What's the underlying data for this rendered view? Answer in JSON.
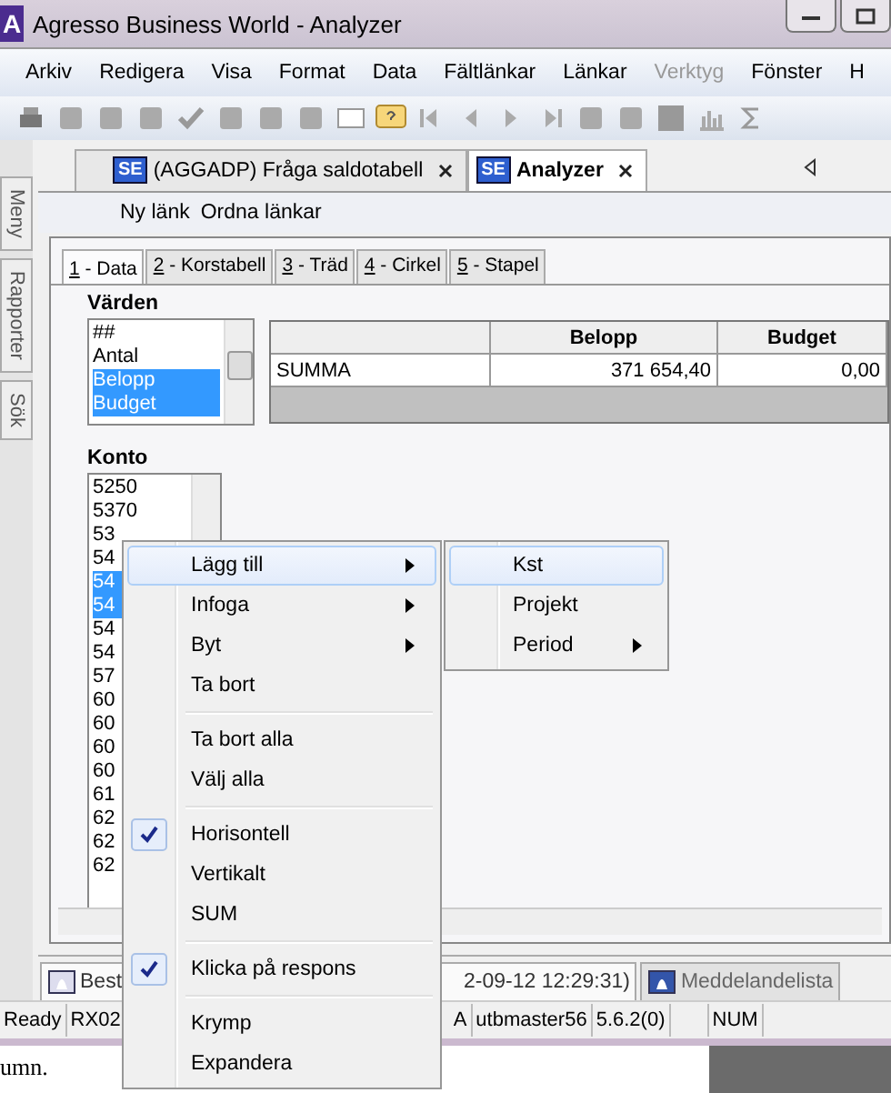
{
  "window": {
    "title": "Agresso Business World - Analyzer",
    "logo": "A"
  },
  "menu_bar": [
    {
      "label": "Arkiv",
      "disabled": false
    },
    {
      "label": "Redigera",
      "disabled": false
    },
    {
      "label": "Visa",
      "disabled": false
    },
    {
      "label": "Format",
      "disabled": false
    },
    {
      "label": "Data",
      "disabled": false
    },
    {
      "label": "Fältlänkar",
      "disabled": false
    },
    {
      "label": "Länkar",
      "disabled": false
    },
    {
      "label": "Verktyg",
      "disabled": true
    },
    {
      "label": "Fönster",
      "disabled": false
    },
    {
      "label": "H",
      "disabled": false
    }
  ],
  "side_tabs": [
    "Meny",
    "Rapporter",
    "Sök"
  ],
  "doc_tabs": [
    {
      "icon_text": "SE",
      "label": "(AGGADP) Fråga saldotabell",
      "selected": false
    },
    {
      "icon_text": "SE",
      "label": "Analyzer",
      "selected": true
    }
  ],
  "link_bar": [
    "Ny länk",
    "Ordna länkar"
  ],
  "view_tabs": [
    {
      "label": "1 - Data",
      "selected": true
    },
    {
      "label": "2 - Korstabell",
      "selected": false
    },
    {
      "label": "3 - Träd",
      "selected": false
    },
    {
      "label": "4 - Cirkel",
      "selected": false
    },
    {
      "label": "5 - Stapel",
      "selected": false
    }
  ],
  "values": {
    "label": "Värden",
    "items": [
      {
        "label": "##",
        "selected": false
      },
      {
        "label": "Antal",
        "selected": false
      },
      {
        "label": "Belopp",
        "selected": true
      },
      {
        "label": "Budget",
        "selected": true
      }
    ]
  },
  "grid": {
    "columns": [
      "Belopp",
      "Budget"
    ],
    "rows": [
      {
        "label": "SUMMA",
        "cells": [
          "371 654,40",
          "0,00"
        ]
      }
    ]
  },
  "konto": {
    "label": "Konto",
    "items": [
      {
        "label": "5250",
        "selected": false
      },
      {
        "label": "5370",
        "selected": false
      },
      {
        "label": "53",
        "selected": false
      },
      {
        "label": "54",
        "selected": false
      },
      {
        "label": "54",
        "selected": true
      },
      {
        "label": "54",
        "selected": true
      },
      {
        "label": "54",
        "selected": false
      },
      {
        "label": "54",
        "selected": false
      },
      {
        "label": "57",
        "selected": false
      },
      {
        "label": "60",
        "selected": false
      },
      {
        "label": "60",
        "selected": false
      },
      {
        "label": "60",
        "selected": false
      },
      {
        "label": "60",
        "selected": false
      },
      {
        "label": "61",
        "selected": false
      },
      {
        "label": "62",
        "selected": false
      },
      {
        "label": "62",
        "selected": false
      },
      {
        "label": "62",
        "selected": false
      }
    ]
  },
  "bottom_tabs": [
    {
      "parts": [
        "Best",
        "2-09-12 12:29:31)"
      ],
      "selected": true
    },
    {
      "parts": [
        "Meddelandelista"
      ],
      "selected": false
    }
  ],
  "status_bar": {
    "left": [
      "Ready",
      "RX02"
    ],
    "right": [
      "A",
      "utbmaster56",
      "5.6.2(0)",
      "NUM"
    ]
  },
  "background_text": "umn.",
  "context_menu": [
    {
      "kind": "item",
      "label": "Lägg till",
      "submenu": true,
      "checked": false,
      "selected": true
    },
    {
      "kind": "item",
      "label": "Infoga",
      "submenu": true,
      "checked": false,
      "selected": false
    },
    {
      "kind": "item",
      "label": "Byt",
      "submenu": true,
      "checked": false,
      "selected": false
    },
    {
      "kind": "item",
      "label": "Ta bort",
      "submenu": false,
      "checked": false,
      "selected": false
    },
    {
      "kind": "separator"
    },
    {
      "kind": "item",
      "label": "Ta bort alla",
      "submenu": false,
      "checked": false,
      "selected": false
    },
    {
      "kind": "item",
      "label": "Välj alla",
      "submenu": false,
      "checked": false,
      "selected": false
    },
    {
      "kind": "separator"
    },
    {
      "kind": "item",
      "label": "Horisontell",
      "submenu": false,
      "checked": true,
      "selected": false
    },
    {
      "kind": "item",
      "label": "Vertikalt",
      "submenu": false,
      "checked": false,
      "selected": false
    },
    {
      "kind": "item",
      "label": "SUM",
      "submenu": false,
      "checked": false,
      "selected": false
    },
    {
      "kind": "separator"
    },
    {
      "kind": "item",
      "label": "Klicka på respons",
      "submenu": false,
      "checked": true,
      "selected": false
    },
    {
      "kind": "separator"
    },
    {
      "kind": "item",
      "label": "Krymp",
      "submenu": false,
      "checked": false,
      "selected": false
    },
    {
      "kind": "item",
      "label": "Expandera",
      "submenu": false,
      "checked": false,
      "selected": false
    }
  ],
  "submenu": [
    {
      "label": "Kst",
      "submenu": false,
      "selected": true
    },
    {
      "label": "Projekt",
      "submenu": false,
      "selected": false
    },
    {
      "label": "Period",
      "submenu": true,
      "selected": false
    }
  ]
}
